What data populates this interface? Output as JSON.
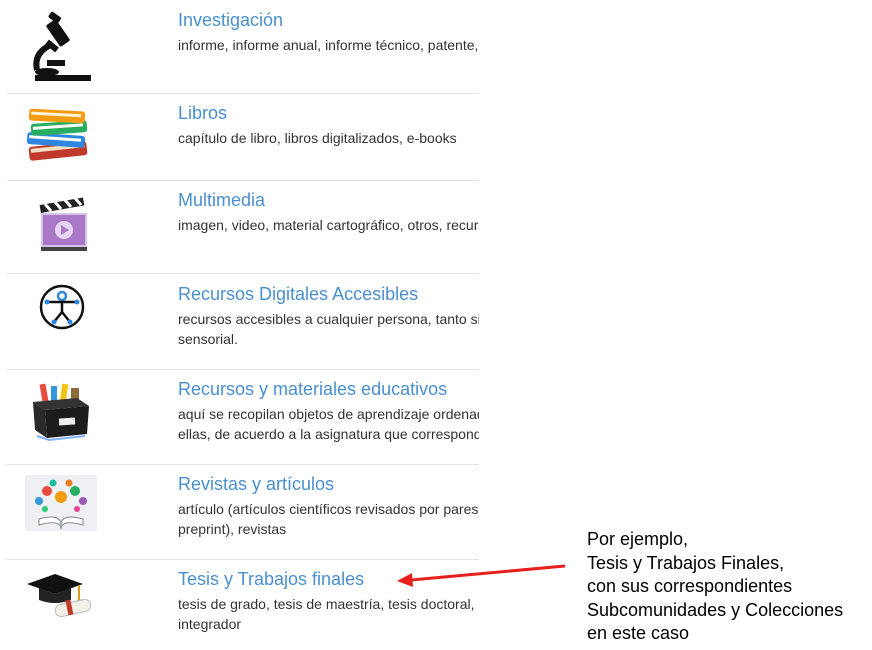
{
  "communities": [
    {
      "title": "Investigación",
      "desc": [
        "informe, informe anual, informe técnico, patente,"
      ],
      "icon": "microscope-icon"
    },
    {
      "title": "Libros",
      "desc": [
        "capítulo de libro, libros digitalizados, e-books"
      ],
      "icon": "books-icon"
    },
    {
      "title": "Multimedia",
      "desc": [
        "imagen, video, material cartográfico, otros, recursos"
      ],
      "icon": "clapperboard-icon"
    },
    {
      "title": "Recursos Digitales Accesibles",
      "desc": [
        "recursos accesibles a cualquier persona, tanto si",
        "sensorial."
      ],
      "icon": "accessibility-icon"
    },
    {
      "title": "Recursos y materiales educativos",
      "desc": [
        "aquí se recopilan objetos de aprendizaje ordenados",
        "ellas, de acuerdo a la asignatura que corresponden"
      ],
      "icon": "box-of-materials-icon"
    },
    {
      "title": "Revistas y artículos",
      "desc": [
        "artículo (artículos científicos revisados por pares),",
        "preprint), revistas"
      ],
      "icon": "open-book-icons-icon"
    },
    {
      "title": "Tesis y Trabajos finales",
      "desc": [
        "tesis de grado, tesis de maestría, tesis doctoral, s",
        "integrador"
      ],
      "icon": "graduation-cap-icon"
    }
  ],
  "annotation": {
    "lines": [
      "Por ejemplo,",
      "Tesis y Trabajos Finales,",
      "con sus correspondientes",
      "Subcomunidades y Colecciones",
      "en este caso"
    ],
    "arrow_color": "#e8201c"
  }
}
